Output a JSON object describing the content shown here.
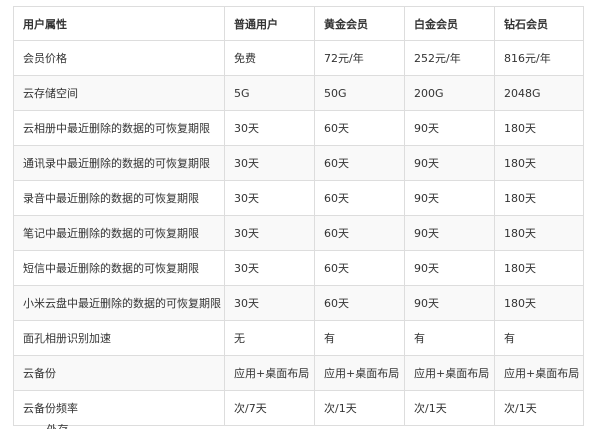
{
  "table": {
    "headers": [
      "用户属性",
      "普通用户",
      "黄金会员",
      "白金会员",
      "钻石会员"
    ],
    "rows": [
      [
        "会员价格",
        "免费",
        "72元/年",
        "252元/年",
        "816元/年"
      ],
      [
        "云存储空间",
        "5G",
        "50G",
        "200G",
        "2048G"
      ],
      [
        "云相册中最近删除的数据的可恢复期限",
        "30天",
        "60天",
        "90天",
        "180天"
      ],
      [
        "通讯录中最近删除的数据的可恢复期限",
        "30天",
        "60天",
        "90天",
        "180天"
      ],
      [
        "录音中最近删除的数据的可恢复期限",
        "30天",
        "60天",
        "90天",
        "180天"
      ],
      [
        "笔记中最近删除的数据的可恢复期限",
        "30天",
        "60天",
        "90天",
        "180天"
      ],
      [
        "短信中最近删除的数据的可恢复期限",
        "30天",
        "60天",
        "90天",
        "180天"
      ],
      [
        "小米云盘中最近删除的数据的可恢复期限",
        "30天",
        "60天",
        "90天",
        "180天"
      ],
      [
        "面孔相册识别加速",
        "无",
        "有",
        "有",
        "有"
      ],
      [
        "云备份",
        "应用+桌面布局",
        "应用+桌面布局",
        "应用+桌面布局",
        "应用+桌面布局"
      ],
      [
        "云备份频率",
        "次/7天",
        "次/1天",
        "次/1天",
        "次/1天"
      ]
    ]
  },
  "footer": {
    "cut_text": "…… 外存"
  },
  "colors": {
    "border": "#dddddd",
    "text": "#333333",
    "row_alt": "#f9f9f9"
  }
}
